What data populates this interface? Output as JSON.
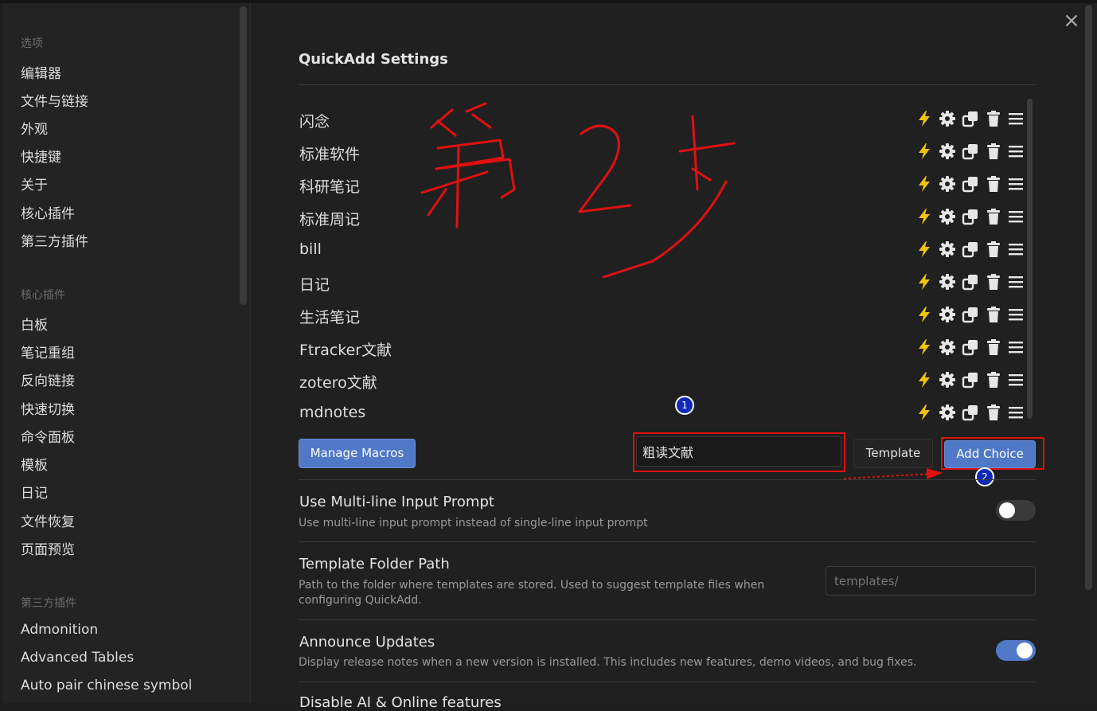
{
  "sidebar": {
    "sections": [
      {
        "title": "选项",
        "items": [
          "编辑器",
          "文件与链接",
          "外观",
          "快捷键",
          "关于",
          "核心插件",
          "第三方插件"
        ]
      },
      {
        "title": "核心插件",
        "items": [
          "白板",
          "笔记重组",
          "反向链接",
          "快速切换",
          "命令面板",
          "模板",
          "日记",
          "文件恢复",
          "页面预览"
        ]
      },
      {
        "title": "第三方插件",
        "items": [
          "Admonition",
          "Advanced Tables",
          "Auto pair chinese symbol"
        ]
      }
    ]
  },
  "header": {
    "title": "QuickAdd Settings",
    "close_symbol": "×"
  },
  "choices": [
    "闪念",
    "标准软件",
    "科研笔记",
    "标准周记",
    "bill",
    "日记",
    "生活笔记",
    "Ftracker文献",
    "zotero文献",
    "mdnotes"
  ],
  "choice_icons": [
    "bolt-icon",
    "gear-icon",
    "duplicate-icon",
    "trash-icon",
    "drag-handle-icon"
  ],
  "actions": {
    "manage_macros": "Manage Macros",
    "choice_name_value": "粗读文献",
    "type_select": "Template",
    "add_choice": "Add Choice"
  },
  "annotations": {
    "badge1": "1",
    "badge2": "2",
    "handwriting": "第2步"
  },
  "settings": [
    {
      "name": "Use Multi-line Input Prompt",
      "desc": "Use multi-line input prompt instead of single-line input prompt",
      "toggle": false
    },
    {
      "name": "Template Folder Path",
      "desc": "Path to the folder where templates are stored. Used to suggest template files when configuring QuickAdd.",
      "placeholder": "templates/"
    },
    {
      "name": "Announce Updates",
      "desc": "Display release notes when a new version is installed. This includes new features, demo videos, and bug fixes.",
      "toggle": true
    },
    {
      "name": "Disable AI & Online features"
    }
  ],
  "colors": {
    "accent": "#4f78c7",
    "annotation_red": "#e01010",
    "bolt": "#f2c20f"
  }
}
